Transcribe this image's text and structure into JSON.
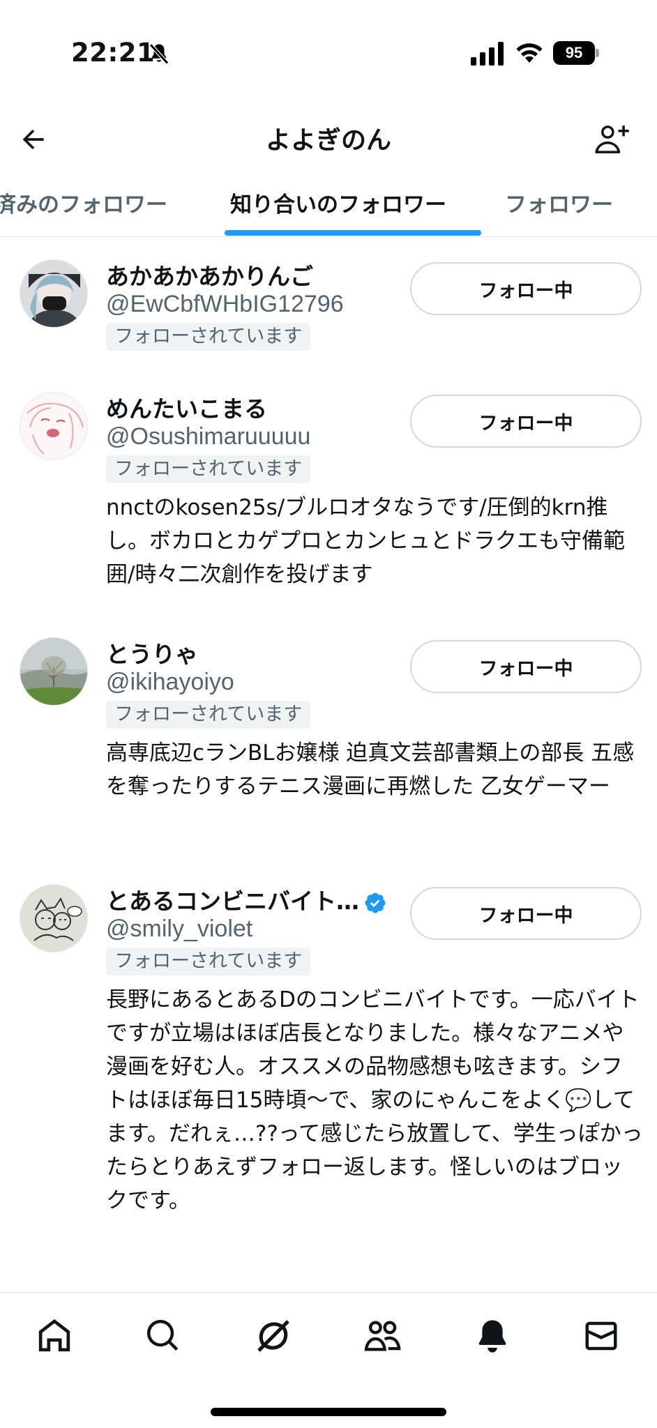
{
  "status_bar": {
    "time": "22:21",
    "battery": "95",
    "icons": [
      "bell-off-icon",
      "signal-icon",
      "wifi-icon",
      "battery-icon"
    ]
  },
  "header": {
    "title": "よよぎのん",
    "back_icon": "arrow-left-icon",
    "add_icon": "add-user-icon"
  },
  "tabs": [
    {
      "label": "済みのフォロワー",
      "active": false
    },
    {
      "label": "知り合いのフォロワー",
      "active": true
    },
    {
      "label": "フォロワー",
      "active": false
    }
  ],
  "users": [
    {
      "name": "あかあかあかりんご",
      "handle": "@EwCbfWHbIG12796",
      "badge": "フォローされています",
      "button": "フォロー中",
      "bio": "",
      "verified": false
    },
    {
      "name": "めんたいこまる",
      "handle": "@Osushimaruuuuu",
      "badge": "フォローされています",
      "button": "フォロー中",
      "bio": "nnctのkosen25s/ブルロオタなうです/圧倒的krn推し。ボカロとカゲプロとカンヒュとドラクエも守備範囲/時々二次創作を投げます",
      "verified": false
    },
    {
      "name": "とうりゃ",
      "handle": "@ikihayoiyo",
      "badge": "フォローされています",
      "button": "フォロー中",
      "bio": "高専底辺cランBLお嬢様 迫真文芸部書類上の部長 五感を奪ったりするテニス漫画に再燃した 乙女ゲーマー",
      "verified": false
    },
    {
      "name": "とあるコンビニバイト…",
      "handle": "@smily_violet",
      "badge": "フォローされています",
      "button": "フォロー中",
      "bio": "長野にあるとあるDのコンビニバイトです。一応バイトですが立場はほぼ店長となりました。様々なアニメや漫画を好む人。オススメの品物感想も呟きます。シフトはほぼ毎日15時頃〜で、家のにゃんこをよく💬してます。だれぇ…??って感じたら放置して、学生っぽかったらとりあえずフォロー返します。怪しいのはブロックです。",
      "verified": true
    }
  ],
  "bottom_nav": [
    "home-icon",
    "search-icon",
    "grok-icon",
    "communities-icon",
    "notifications-icon",
    "messages-icon"
  ],
  "colors": {
    "accent": "#1d9bf0",
    "text": "#0f1419",
    "secondary_text": "#536471",
    "border": "#cfd9de",
    "badge_bg": "#eff3f4"
  }
}
